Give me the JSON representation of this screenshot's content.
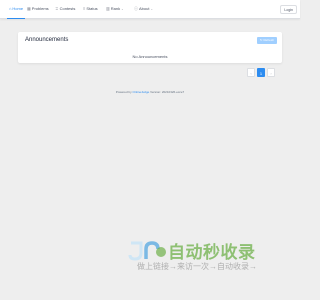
{
  "nav": {
    "items": [
      {
        "label": "Home",
        "icon": "home-icon",
        "glyph": "⌂",
        "active": true
      },
      {
        "label": "Problems",
        "icon": "grid-icon",
        "glyph": "▦",
        "active": false
      },
      {
        "label": "Contests",
        "icon": "trophy-icon",
        "glyph": "♖",
        "active": false
      },
      {
        "label": "Status",
        "icon": "status-icon",
        "glyph": "≡",
        "active": false
      },
      {
        "label": "Rank",
        "icon": "rank-icon",
        "glyph": "▥",
        "active": false,
        "dropdown": true
      },
      {
        "label": "About",
        "icon": "info-icon",
        "glyph": "ⓘ",
        "active": false,
        "dropdown": true
      }
    ],
    "login_label": "Login",
    "chevron": "⌄"
  },
  "announcements": {
    "title": "Announcements",
    "refresh_label": "Refresh",
    "refresh_glyph": "↻",
    "empty_text": "No Announcements"
  },
  "pagination": {
    "prev": "‹",
    "current": "1",
    "next": "›"
  },
  "footer": {
    "powered_by": "Powered by",
    "project": "OnlineJudge",
    "version": "Version: 20210326-ecce7"
  },
  "watermark": {
    "title": "自动秒收录",
    "subtitle": "做上链接→来访一次→自动收录→"
  },
  "colors": {
    "accent": "#2d8cf0",
    "refresh_button": "#a0cfff",
    "background": "#eeeeee",
    "watermark_green": "#6fb14a"
  }
}
